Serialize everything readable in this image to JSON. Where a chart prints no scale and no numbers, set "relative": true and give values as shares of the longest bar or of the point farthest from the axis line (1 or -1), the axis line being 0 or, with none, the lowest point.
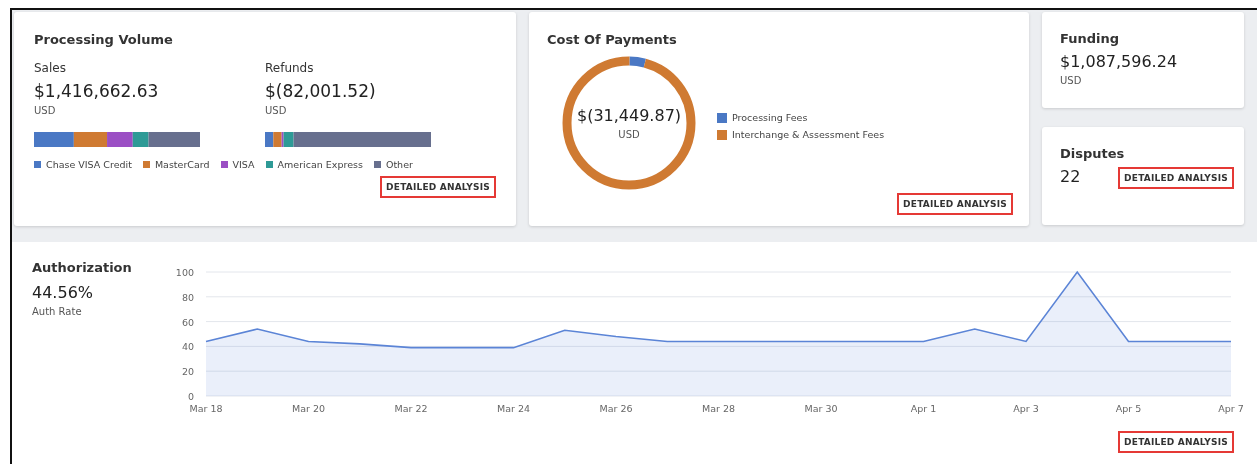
{
  "processing_volume": {
    "title": "Processing Volume",
    "sales": {
      "label": "Sales",
      "amount": "$1,416,662.63",
      "currency": "USD",
      "chart_data": {
        "type": "bar",
        "orientation": "horizontal",
        "stacked": true,
        "relative": true,
        "series": [
          {
            "color": "#4a78c4",
            "values": [
              0.24
            ]
          },
          {
            "color": "#cf7a32",
            "values": [
              0.2
            ]
          },
          {
            "color": "#9b4fc4",
            "values": [
              0.155
            ]
          },
          {
            "color": "#2e9a96",
            "values": [
              0.095
            ]
          },
          {
            "color": "#676f8e",
            "values": [
              0.31
            ]
          }
        ]
      }
    },
    "refunds": {
      "label": "Refunds",
      "amount": "$(82,001.52)",
      "currency": "USD",
      "chart_data": {
        "type": "bar",
        "orientation": "horizontal",
        "stacked": true,
        "relative": true,
        "series": [
          {
            "color": "#4a78c4",
            "values": [
              0.05
            ]
          },
          {
            "color": "#cf7a32",
            "values": [
              0.05
            ]
          },
          {
            "color": "#9b4fc4",
            "values": [
              0.012
            ]
          },
          {
            "color": "#2e9a96",
            "values": [
              0.06
            ]
          },
          {
            "color": "#676f8e",
            "values": [
              0.828
            ]
          }
        ]
      }
    },
    "legend": [
      {
        "label": "Chase VISA Credit",
        "color": "#4a78c4"
      },
      {
        "label": "MasterCard",
        "color": "#cf7a32"
      },
      {
        "label": "VISA",
        "color": "#9b4fc4"
      },
      {
        "label": "American Express",
        "color": "#2e9a96"
      },
      {
        "label": "Other",
        "color": "#676f8e"
      }
    ],
    "button": "DETAILED ANALYSIS"
  },
  "cost_of_payments": {
    "title": "Cost Of Payments",
    "amount": "$(31,449.87)",
    "currency": "USD",
    "legend": [
      {
        "label": "Processing Fees",
        "color": "#4a78c4",
        "level": 0.04
      },
      {
        "label": "Interchange & Assessment Fees",
        "color": "#cf7a32",
        "level": 0.96
      }
    ],
    "button": "DETAILED ANALYSIS"
  },
  "funding": {
    "title": "Funding",
    "amount": "$1,087,596.24",
    "currency": "USD"
  },
  "disputes": {
    "title": "Disputes",
    "count": "22",
    "button": "DETAILED ANALYSIS"
  },
  "authorization": {
    "title": "Authorization",
    "rate": "44.56%",
    "rate_label": "Auth Rate",
    "chart_data": {
      "type": "area",
      "categories": [
        "Mar 18",
        null,
        "Mar 20",
        null,
        "Mar 22",
        null,
        "Mar 24",
        null,
        "Mar 26",
        null,
        "Mar 28",
        null,
        "Mar 30",
        null,
        "Apr 1",
        null,
        "Apr 3",
        null,
        "Apr 5",
        null,
        "Apr 7"
      ],
      "series": [
        {
          "color": "#5b84d6",
          "values": [
            44,
            54,
            44,
            42,
            39,
            39,
            39,
            53,
            48,
            44,
            44,
            44,
            44,
            44,
            44,
            54,
            44,
            100,
            44,
            44,
            44
          ]
        }
      ],
      "ylim": [
        0,
        100
      ],
      "yticks": [
        0,
        20,
        40,
        60,
        80,
        100
      ],
      "grid": true
    },
    "button": "DETAILED ANALYSIS"
  }
}
